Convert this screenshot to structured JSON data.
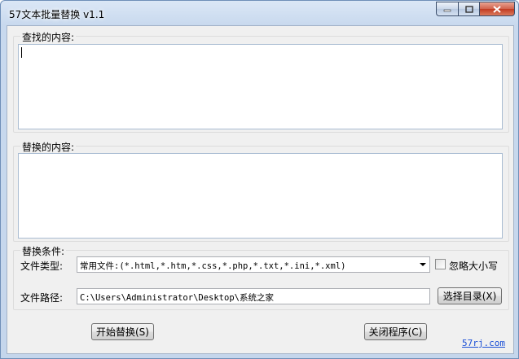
{
  "window": {
    "title": "57文本批量替换 v1.1"
  },
  "find_section": {
    "label": "查找的内容:",
    "value": ""
  },
  "replace_section": {
    "label": "替换的内容:",
    "value": ""
  },
  "conditions": {
    "label": "替换条件:",
    "file_type_label": "文件类型:",
    "file_type_value": "常用文件:(*.html,*.htm,*.css,*.php,*.txt,*.ini,*.xml)",
    "ignore_case_label": "忽略大小写",
    "ignore_case_checked": false,
    "path_label": "文件路径:",
    "path_value": "C:\\Users\\Administrator\\Desktop\\系统之家",
    "browse_button": "选择目录(X)"
  },
  "actions": {
    "start_button": "开始替换(S)",
    "close_button": "关闭程序(C)"
  },
  "footer": {
    "site": "57rj.com"
  }
}
